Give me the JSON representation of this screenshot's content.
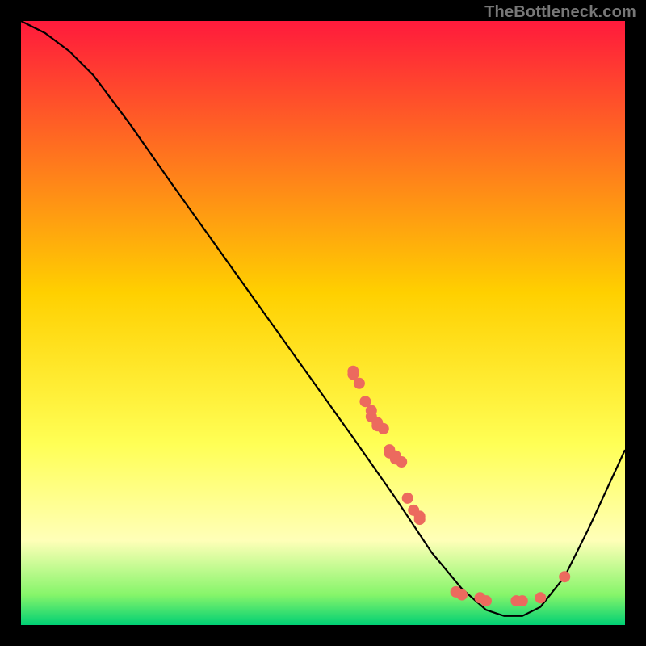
{
  "attribution": "TheBottleneck.com",
  "colors": {
    "page_bg": "#000000",
    "gradient_stops": [
      {
        "offset": "0%",
        "color": "#ff1a3c"
      },
      {
        "offset": "45%",
        "color": "#ffd000"
      },
      {
        "offset": "70%",
        "color": "#ffff55"
      },
      {
        "offset": "86%",
        "color": "#ffffb8"
      },
      {
        "offset": "95%",
        "color": "#86f56a"
      },
      {
        "offset": "100%",
        "color": "#00d074"
      }
    ],
    "curve": "#000000",
    "dot_fill": "#ec6a5e",
    "dot_stroke": "#b94a45"
  },
  "chart_data": {
    "type": "line",
    "title": "",
    "xlabel": "",
    "ylabel": "",
    "xlim": [
      0,
      100
    ],
    "ylim": [
      0,
      100
    ],
    "curve_points": [
      {
        "x": 0,
        "y": 100
      },
      {
        "x": 4,
        "y": 98
      },
      {
        "x": 8,
        "y": 95
      },
      {
        "x": 12,
        "y": 91
      },
      {
        "x": 18,
        "y": 83
      },
      {
        "x": 25,
        "y": 73
      },
      {
        "x": 35,
        "y": 59
      },
      {
        "x": 45,
        "y": 45
      },
      {
        "x": 55,
        "y": 31
      },
      {
        "x": 62,
        "y": 21
      },
      {
        "x": 68,
        "y": 12
      },
      {
        "x": 73,
        "y": 6
      },
      {
        "x": 77,
        "y": 2.5
      },
      {
        "x": 80,
        "y": 1.5
      },
      {
        "x": 83,
        "y": 1.5
      },
      {
        "x": 86,
        "y": 3
      },
      {
        "x": 90,
        "y": 8
      },
      {
        "x": 94,
        "y": 16
      },
      {
        "x": 100,
        "y": 29
      }
    ],
    "series": [
      {
        "name": "highlighted-points",
        "values": [
          {
            "x": 55,
            "y": 42.0
          },
          {
            "x": 55,
            "y": 41.5
          },
          {
            "x": 56,
            "y": 40.0
          },
          {
            "x": 57,
            "y": 37.0
          },
          {
            "x": 58,
            "y": 35.5
          },
          {
            "x": 58,
            "y": 34.5
          },
          {
            "x": 59,
            "y": 33.5
          },
          {
            "x": 59,
            "y": 33.0
          },
          {
            "x": 60,
            "y": 32.5
          },
          {
            "x": 61,
            "y": 29.0
          },
          {
            "x": 61,
            "y": 28.5
          },
          {
            "x": 62,
            "y": 28.0
          },
          {
            "x": 62,
            "y": 27.5
          },
          {
            "x": 63,
            "y": 27.0
          },
          {
            "x": 64,
            "y": 21.0
          },
          {
            "x": 65,
            "y": 19.0
          },
          {
            "x": 66,
            "y": 18.0
          },
          {
            "x": 66,
            "y": 17.5
          },
          {
            "x": 72,
            "y": 5.5
          },
          {
            "x": 73,
            "y": 5.0
          },
          {
            "x": 76,
            "y": 4.5
          },
          {
            "x": 77,
            "y": 4.0
          },
          {
            "x": 82,
            "y": 4.0
          },
          {
            "x": 83,
            "y": 4.0
          },
          {
            "x": 86,
            "y": 4.5
          },
          {
            "x": 90,
            "y": 8.0
          }
        ]
      }
    ]
  }
}
